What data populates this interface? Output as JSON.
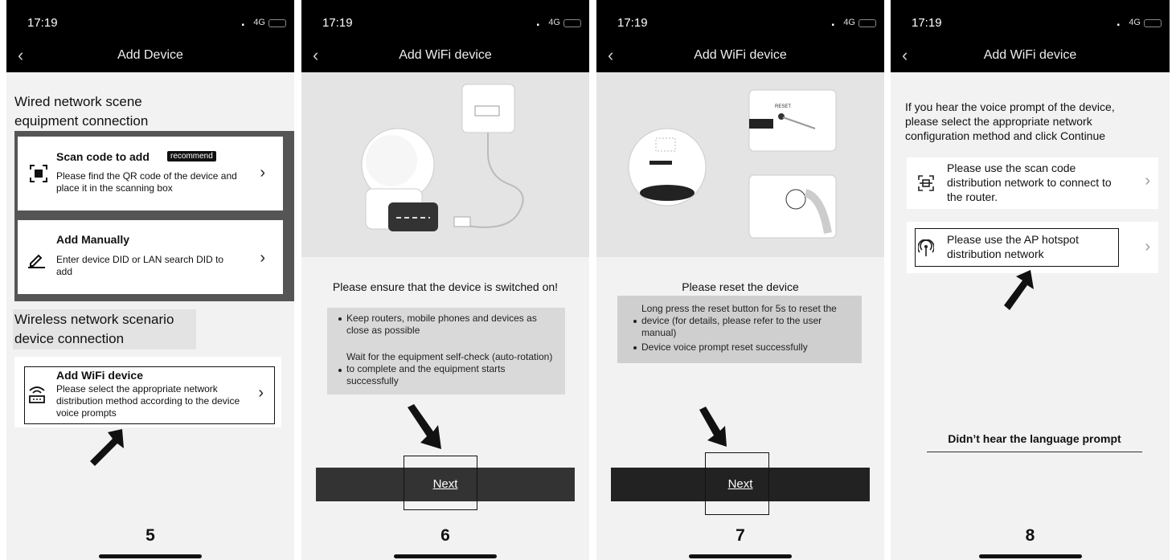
{
  "status": {
    "time": "17:19",
    "network": "4G"
  },
  "screens": [
    {
      "title": "Add Device",
      "wired_section": "Wired network scene equipment connection",
      "scan_card": {
        "title": "Scan code to add",
        "badge": "recommend",
        "desc": "Please find the QR code of the device and place it in the scanning box"
      },
      "manual_card": {
        "title": "Add Manually",
        "desc": "Enter device DID or LAN search DID to add"
      },
      "wireless_section": "Wireless network scenario device connection",
      "wifi_card": {
        "title": "Add WiFi device",
        "desc": "Please select the appropriate network distribution method according to the device voice prompts"
      },
      "step": "5"
    },
    {
      "title": "Add WiFi device",
      "heading": "Please ensure that the device is switched on!",
      "tips": [
        "Keep routers, mobile phones and devices as close as possible",
        "Wait for the equipment self-check (auto-rotation) to complete and the equipment starts successfully"
      ],
      "next": "Next",
      "step": "6"
    },
    {
      "title": "Add WiFi device",
      "heading": "Please reset the device",
      "reset_label": "RESET",
      "tips": [
        "Long press the reset button for 5s to reset the device (for details, please refer to the user manual)",
        "Device voice prompt reset successfully"
      ],
      "next": "Next",
      "step": "7"
    },
    {
      "title": "Add WiFi device",
      "intro": "If you hear the voice prompt of the device, please select the appropriate network configuration method and click Continue",
      "options": [
        "Please use the scan code distribution network to connect to the router.",
        "Please use the AP hotspot distribution network"
      ],
      "no_prompt_link": "Didn’t hear the language prompt",
      "step": "8"
    }
  ],
  "icons": {
    "back": "chevron-left-icon",
    "chevron": "chevron-right-icon",
    "scan": "qr-scan-icon",
    "edit": "edit-pen-icon",
    "router": "wifi-router-icon",
    "scan_frame": "scan-frame-icon",
    "hotspot": "hotspot-icon"
  }
}
